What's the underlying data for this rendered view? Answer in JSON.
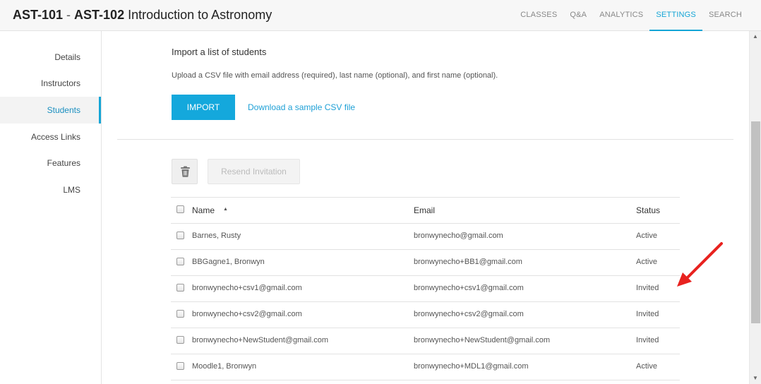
{
  "header": {
    "code1": "AST-101",
    "separator": " - ",
    "code2": "AST-102",
    "course_name": " Introduction to Astronomy",
    "nav": [
      "CLASSES",
      "Q&A",
      "ANALYTICS",
      "SETTINGS",
      "SEARCH"
    ],
    "active_nav": "SETTINGS"
  },
  "sidebar": {
    "items": [
      "Details",
      "Instructors",
      "Students",
      "Access Links",
      "Features",
      "LMS"
    ],
    "active": "Students"
  },
  "import": {
    "heading": "Import a list of students",
    "description": "Upload a CSV file with email address (required), last name (optional), and first name (optional).",
    "button_label": "IMPORT",
    "sample_link": "Download a sample CSV file"
  },
  "toolbar": {
    "trash_icon": "trash-icon",
    "resend_label": "Resend Invitation"
  },
  "table": {
    "headers": {
      "name": "Name",
      "sort_icon": "▲",
      "email": "Email",
      "status": "Status"
    },
    "rows": [
      {
        "name": "Barnes, Rusty",
        "email": "bronwynecho@gmail.com",
        "status": "Active"
      },
      {
        "name": "BBGagne1, Bronwyn",
        "email": "bronwynecho+BB1@gmail.com",
        "status": "Active"
      },
      {
        "name": "bronwynecho+csv1@gmail.com",
        "email": "bronwynecho+csv1@gmail.com",
        "status": "Invited"
      },
      {
        "name": "bronwynecho+csv2@gmail.com",
        "email": "bronwynecho+csv2@gmail.com",
        "status": "Invited"
      },
      {
        "name": "bronwynecho+NewStudent@gmail.com",
        "email": "bronwynecho+NewStudent@gmail.com",
        "status": "Invited"
      },
      {
        "name": "Moodle1, Bronwyn",
        "email": "bronwynecho+MDL1@gmail.com",
        "status": "Active"
      }
    ]
  },
  "colors": {
    "accent": "#14a8dc",
    "annotation": "#e8221f"
  }
}
